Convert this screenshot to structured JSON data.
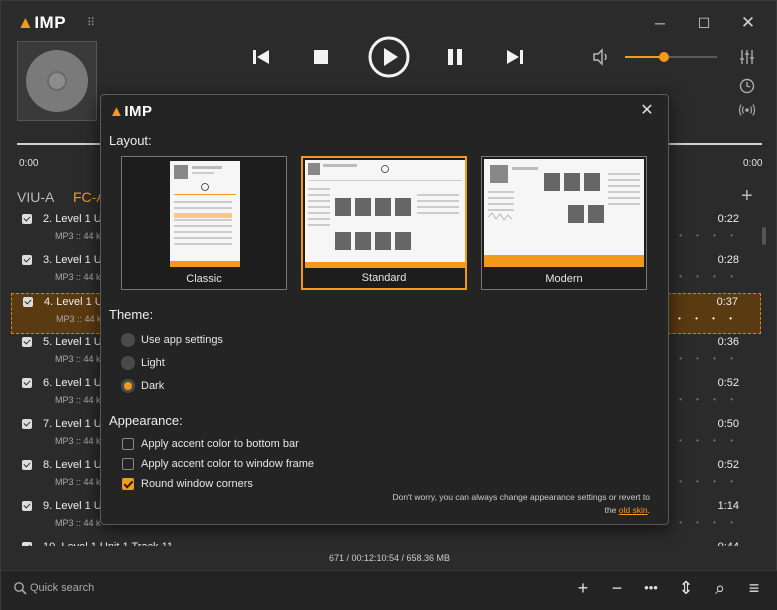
{
  "app": {
    "logo_text": "IMP"
  },
  "window": {
    "minimize_label": "─",
    "maximize_label": "☐",
    "close_label": "✕"
  },
  "player": {
    "time_elapsed": "0:00",
    "time_remaining": "0:00",
    "volume_level": 0.42,
    "icons": {
      "prev": "skip-previous-icon",
      "stop": "stop-icon",
      "play": "play-circle-icon",
      "pause": "pause-icon",
      "next": "skip-next-icon",
      "volume": "volume-icon",
      "equalizer": "equalizer-icon",
      "clock": "clock-icon",
      "radio": "radio-icon"
    }
  },
  "tabs": [
    {
      "label": "VIU-A"
    },
    {
      "label": "FC-A"
    }
  ],
  "playlist": {
    "rows": [
      {
        "title": "2. Level 1 U",
        "info": "MP3 :: 44 k",
        "duration": "0:22",
        "active": false
      },
      {
        "title": "3. Level 1 U",
        "info": "MP3 :: 44 k",
        "duration": "0:28",
        "active": false
      },
      {
        "title": "4. Level 1 U",
        "info": "MP3 :: 44 k",
        "duration": "0:37",
        "active": true
      },
      {
        "title": "5. Level 1 U",
        "info": "MP3 :: 44 k",
        "duration": "0:36",
        "active": false
      },
      {
        "title": "6. Level 1 U",
        "info": "MP3 :: 44 k",
        "duration": "0:52",
        "active": false
      },
      {
        "title": "7. Level 1 U",
        "info": "MP3 :: 44 k",
        "duration": "0:50",
        "active": false
      },
      {
        "title": "8. Level 1 U",
        "info": "MP3 :: 44 k",
        "duration": "0:52",
        "active": false
      },
      {
        "title": "9. Level 1 U",
        "info": "MP3 :: 44 k",
        "duration": "1:14",
        "active": false
      },
      {
        "title": "10. Level 1 Unit 1 Track 11",
        "info": "",
        "duration": "0:44",
        "active": false
      }
    ],
    "rating_dots": "• • • • •"
  },
  "status": {
    "summary": "671 / 00:12:10:54 / 658.36 MB"
  },
  "bottom_bar": {
    "search_placeholder": "Quick search",
    "add_label": "+",
    "remove_label": "−",
    "more_label": "•••",
    "sort_label": "⇕",
    "find_label": "⌕",
    "menu_label": "≡"
  },
  "dialog": {
    "logo_text": "IMP",
    "close_label": "✕",
    "layout_heading": "Layout:",
    "layouts": [
      {
        "label": "Classic",
        "selected": false
      },
      {
        "label": "Standard",
        "selected": true
      },
      {
        "label": "Modern",
        "selected": false
      }
    ],
    "theme_heading": "Theme:",
    "themes": [
      {
        "label": "Use app settings",
        "selected": false
      },
      {
        "label": "Light",
        "selected": false
      },
      {
        "label": "Dark",
        "selected": true
      }
    ],
    "appearance_heading": "Appearance:",
    "options": [
      {
        "label": "Apply accent color to bottom bar",
        "checked": false
      },
      {
        "label": "Apply accent color to window frame",
        "checked": false
      },
      {
        "label": "Round window corners",
        "checked": true
      }
    ],
    "hint_text": "Don't worry, you can always change appearance settings or revert to",
    "hint_prefix": "the",
    "hint_link": "old skin",
    "hint_suffix": "."
  },
  "colors": {
    "accent": "#f39a1d",
    "background": "#2b2b2b",
    "dialog_background": "#242424"
  }
}
